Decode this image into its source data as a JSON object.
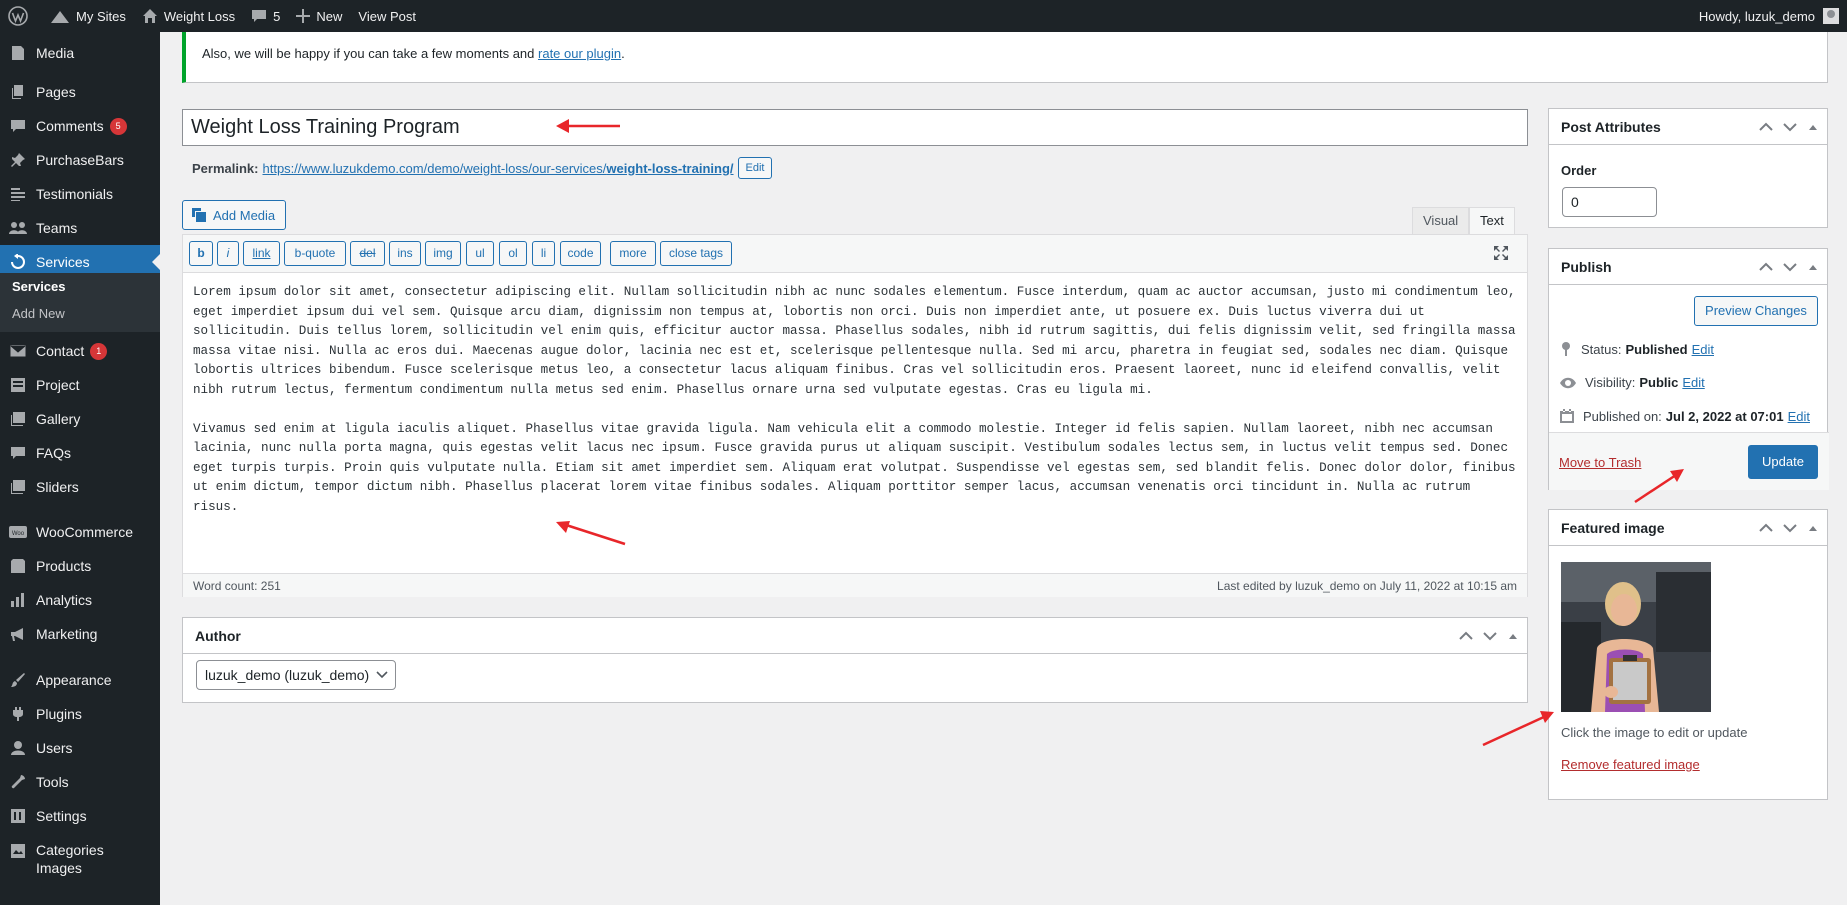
{
  "admin_bar": {
    "my_sites": "My Sites",
    "site_name": "Weight Loss",
    "comments_count": "5",
    "new_label": "New",
    "view_post": "View Post",
    "howdy": "Howdy, luzuk_demo"
  },
  "sidebar": {
    "items": [
      {
        "label": "Media",
        "icon": "media-icon"
      },
      {
        "label": "Pages",
        "icon": "pages-icon"
      },
      {
        "label": "Comments",
        "icon": "comments-icon",
        "badge": "5"
      },
      {
        "label": "PurchaseBars",
        "icon": "pin-icon"
      },
      {
        "label": "Testimonials",
        "icon": "testimonials-icon"
      },
      {
        "label": "Teams",
        "icon": "teams-icon"
      },
      {
        "label": "Services",
        "icon": "services-icon",
        "current": true
      },
      {
        "label": "Contact",
        "icon": "mail-icon",
        "badge": "1"
      },
      {
        "label": "Project",
        "icon": "project-icon"
      },
      {
        "label": "Gallery",
        "icon": "gallery-icon"
      },
      {
        "label": "FAQs",
        "icon": "faq-icon"
      },
      {
        "label": "Sliders",
        "icon": "sliders-icon"
      },
      {
        "label": "WooCommerce",
        "icon": "woo-icon"
      },
      {
        "label": "Products",
        "icon": "products-icon"
      },
      {
        "label": "Analytics",
        "icon": "analytics-icon"
      },
      {
        "label": "Marketing",
        "icon": "megaphone-icon"
      },
      {
        "label": "Appearance",
        "icon": "brush-icon"
      },
      {
        "label": "Plugins",
        "icon": "plugin-icon"
      },
      {
        "label": "Users",
        "icon": "users-icon"
      },
      {
        "label": "Tools",
        "icon": "wrench-icon"
      },
      {
        "label": "Settings",
        "icon": "settings-icon"
      },
      {
        "label": "Categories",
        "label2": "Images",
        "icon": "categories-images-icon"
      }
    ],
    "submenu": {
      "services": "Services",
      "add_new": "Add New"
    }
  },
  "notice": {
    "text": "Also, we will be happy if you can take a few moments and ",
    "link": "rate our plugin",
    "end": "."
  },
  "post": {
    "title": "Weight Loss Training Program",
    "permalink_label": "Permalink:",
    "permalink_base": "https://www.luzukdemo.com/demo/weight-loss/our-services/",
    "permalink_slug": "weight-loss-training/",
    "edit_label": "Edit"
  },
  "editor": {
    "add_media": "Add Media",
    "tabs": [
      "Visual",
      "Text"
    ],
    "active_tab": "Text",
    "quicktags": [
      "b",
      "i",
      "link",
      "b-quote",
      "del",
      "ins",
      "img",
      "ul",
      "ol",
      "li",
      "code",
      "more",
      "close tags"
    ],
    "content_p1": "Lorem ipsum dolor sit amet, consectetur adipiscing elit. Nullam sollicitudin nibh ac nunc sodales elementum. Fusce interdum, quam ac auctor accumsan, justo mi condimentum leo, eget imperdiet ipsum dui vel sem. Quisque arcu diam, dignissim non tempus at, lobortis non orci. Duis non imperdiet ante, ut posuere ex. Duis luctus viverra dui ut sollicitudin. Duis tellus lorem, sollicitudin vel enim quis, efficitur auctor massa. Phasellus sodales, nibh id rutrum sagittis, dui felis dignissim velit, sed fringilla massa massa vitae nisi. Nulla ac eros dui. Maecenas augue dolor, lacinia nec est et, scelerisque pellentesque nulla. Sed mi arcu, pharetra in feugiat sed, sodales nec diam. Quisque lobortis ultrices bibendum. Fusce scelerisque metus leo, a consectetur lacus aliquam finibus. Cras vel sollicitudin eros. Praesent laoreet, nunc id eleifend convallis, velit nibh rutrum lectus, fermentum condimentum nulla metus sed enim. Phasellus ornare urna sed vulputate egestas. Cras eu ligula mi.",
    "content_p2": "Vivamus sed enim at ligula iaculis aliquet. Phasellus vitae gravida ligula. Nam vehicula elit a commodo molestie. Integer id felis sapien. Nullam laoreet, nibh nec accumsan lacinia, nunc nulla porta magna, quis egestas velit lacus nec ipsum. Fusce gravida purus ut aliquam suscipit. Vestibulum sodales lectus sem, in luctus velit tempus sed. Donec eget turpis turpis. Proin quis vulputate nulla. Etiam sit amet imperdiet sem. Aliquam erat volutpat. Suspendisse vel egestas sem, sed blandit felis. Donec dolor dolor, finibus ut enim dictum, tempor dictum nibh. Phasellus placerat lorem vitae finibus sodales. Aliquam porttitor semper lacus, accumsan venenatis orci tincidunt in. Nulla ac rutrum risus.",
    "word_count": "Word count: 251",
    "last_edited": "Last edited by luzuk_demo on July 11, 2022 at 10:15 am"
  },
  "author_box": {
    "title": "Author",
    "selected": "luzuk_demo (luzuk_demo)"
  },
  "post_attributes": {
    "title": "Post Attributes",
    "order_label": "Order",
    "order_value": "0"
  },
  "publish": {
    "title": "Publish",
    "preview": "Preview Changes",
    "status_label": "Status:",
    "status_value": "Published",
    "visibility_label": "Visibility:",
    "visibility_value": "Public",
    "published_label": "Published on:",
    "published_value": "Jul 2, 2022 at 07:01",
    "edit": "Edit",
    "trash": "Move to Trash",
    "update": "Update"
  },
  "featured_image": {
    "title": "Featured image",
    "hint": "Click the image to edit or update",
    "remove": "Remove featured image"
  },
  "colors": {
    "accent": "#2271b1",
    "sidebar_bg": "#1d2327",
    "annotation_arrow": "#e8262a",
    "notice_border": "#00a32a"
  }
}
